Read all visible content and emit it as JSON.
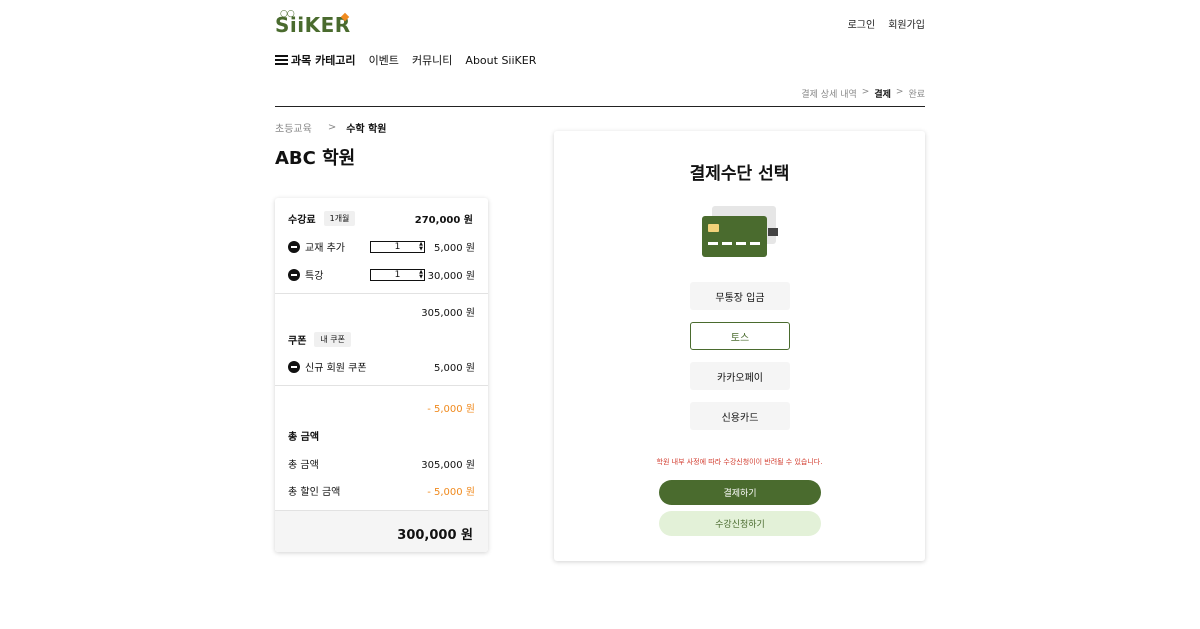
{
  "header": {
    "logo_text": "SiiKER",
    "login_label": "로그인",
    "signup_label": "회원가입"
  },
  "nav": {
    "category_label": "과목 카테고리",
    "items": [
      "이벤트",
      "커뮤니티",
      "About SiiKER"
    ]
  },
  "steps": {
    "step1": "결제 상세 내역",
    "step2": "결제",
    "step3": "완료",
    "separator": ">"
  },
  "breadcrumb": {
    "parent": "초등교육",
    "separator": ">",
    "current": "수학 학원"
  },
  "page_title": "ABC 학원",
  "summary": {
    "tuition_label": "수강료",
    "tuition_period": "1개월",
    "tuition_price": "270,000 원",
    "addons": [
      {
        "label": "교재 추가",
        "qty": "1",
        "price": "5,000 원"
      },
      {
        "label": "특강",
        "qty": "1",
        "price": "30,000 원"
      }
    ],
    "subtotal": "305,000 원",
    "coupon_label": "쿠폰",
    "coupon_chip": "내 쿠폰",
    "coupon_item_label": "신규 회원 쿠폰",
    "coupon_item_price": "5,000 원",
    "coupon_discount": "- 5,000 원",
    "total_section_label": "총 금액",
    "total_label": "총 금액",
    "total_value": "305,000 원",
    "discount_label": "총 할인 금액",
    "discount_value": "- 5,000 원",
    "final_total": "300,000 원"
  },
  "payment": {
    "heading": "결제수단 선택",
    "methods": [
      "무통장 입금",
      "토스",
      "카카오페이",
      "신용카드"
    ],
    "selected_method": "토스",
    "notice": "학원 내부 사정에 따라 수강신청이이 반려될 수 있습니다.",
    "pay_button": "결제하기",
    "apply_button": "수강신청하기"
  },
  "colors": {
    "brand_green": "#4a6b2e",
    "light_green": "#e3f1d8",
    "accent_orange": "#f08a1e",
    "warning_red": "#d23a2c"
  }
}
